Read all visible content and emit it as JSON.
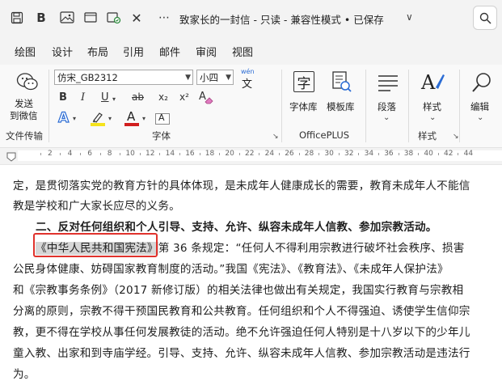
{
  "titlebar": {
    "title": "致家长的一封信 - 只读 - 兼容性模式 • 已保存",
    "chevron": "∨",
    "icons": [
      "save-icon",
      "bold-icon",
      "image-icon",
      "sync-icon",
      "close-icon",
      "search-icon"
    ]
  },
  "tabs": [
    "绘图",
    "设计",
    "布局",
    "引用",
    "邮件",
    "审阅",
    "视图"
  ],
  "ribbon": {
    "send_label_1": "发送",
    "send_label_2": "到微信",
    "group_file_transfer": "文件传输",
    "font_name": "仿宋_GB2312",
    "font_size": "小四",
    "wen_top": "wén",
    "wen_char": "文",
    "format_bold": "B",
    "format_italic": "I",
    "format_underline": "U",
    "format_strike": "ab",
    "format_sub": "x₂",
    "format_sup": "x²",
    "format_clear": "A",
    "group_font": "字体",
    "font_lib_label": "字体库",
    "template_lib_label": "模板库",
    "group_officeplus": "OfficePLUS",
    "paragraph_label": "段落",
    "styles_label": "样式",
    "group_styles": "样式",
    "editing_label": "编辑",
    "expand_glyph": "⌄",
    "launcher_glyph": "↘"
  },
  "ruler": {
    "numbers": [
      "2",
      "4",
      "6",
      "8",
      "10",
      "12",
      "14",
      "16",
      "18",
      "20",
      "22",
      "24",
      "26",
      "28",
      "30",
      "32",
      "34",
      "36",
      "38",
      "40",
      "42",
      "44"
    ]
  },
  "document": {
    "line1": "定，是贯彻落实党的教育方针的具体体现，是未成年人健康成长的需要，教育未成年人不能信",
    "line2": "教是学校和广大家长应尽的义务。",
    "line3": "二、反对任何组织和个人引导、支持、允许、纵容未成年人信教、参加宗教活动。",
    "line4_highlight": "《中华人民共和国宪法》",
    "line4_rest": "第 36 条规定：“任何人不得利用宗教进行破坏社会秩序、损害",
    "line5": "公民身体健康、妨碍国家教育制度的活动。”我国《宪法》、《教育法》、《未成年人保护法》",
    "line6": "和《宗教事务条例》（2017 新修订版）的相关法律也做出有关规定，我国实行教育与宗教相",
    "line7": "分离的原则，宗教不得干预国民教育和公共教育。任何组织和个人不得强迫、诱使学生信仰宗",
    "line8": "教，更不得在学校从事任何发展教徒的活动。绝不允许强迫任何人特别是十八岁以下的少年儿",
    "line9": "童入教、出家和到寺庙学经。引导、支持、允许、纵容未成年人信教、参加宗教活动是违法行",
    "line10": "为。"
  },
  "colors": {
    "highlighter": "#f5e31c",
    "font_color": "#d11e1e",
    "text_effect": "#2b6cd4",
    "annotation_box": "#e0322c"
  }
}
